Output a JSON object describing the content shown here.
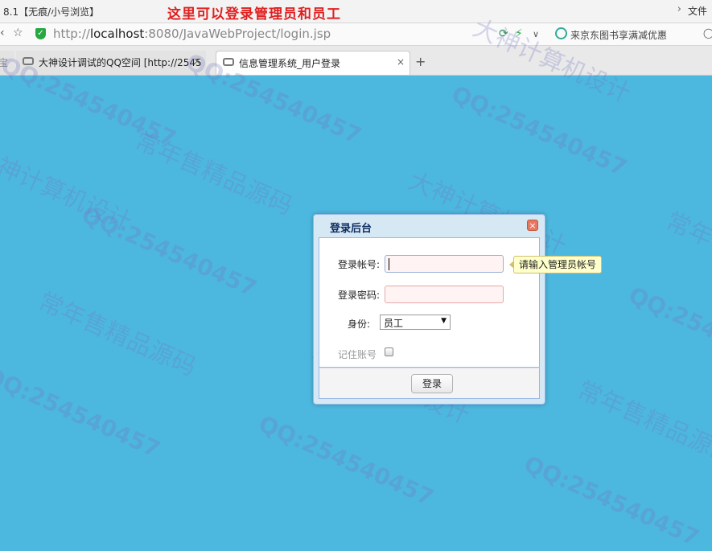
{
  "window": {
    "title": "8.1【无痕/小号浏览】",
    "annotation": "这里可以登录管理员和员工",
    "file_menu": "文件"
  },
  "address_bar": {
    "url_prefix": "http://",
    "url_host": "localhost",
    "url_rest": ":8080/JavaWebProject/login.jsp",
    "search_hint": "来京东图书享满减优惠"
  },
  "tabs": [
    {
      "label": "大神设计调试的QQ空间 [http://2545"
    },
    {
      "label": "信息管理系统_用户登录"
    }
  ],
  "dialog": {
    "title": "登录后台",
    "account_label": "登录帐号:",
    "account_value": "",
    "password_label": "登录密码:",
    "password_value": "",
    "role_label": "身份:",
    "role_selected": "员工",
    "remember_label": "记住账号",
    "remember_checked": false,
    "login_button": "登录"
  },
  "tooltip": {
    "text": "请输入管理员帐号"
  },
  "watermarks": {
    "qq": "QQ:254540457",
    "shop": "常年售精品源码",
    "design": "大神计算机设计"
  },
  "colors": {
    "page_background": "#4db8df",
    "annotation": "#e02020",
    "dialog_border": "#95b8e7",
    "invalid_input": "#fff3f3"
  }
}
